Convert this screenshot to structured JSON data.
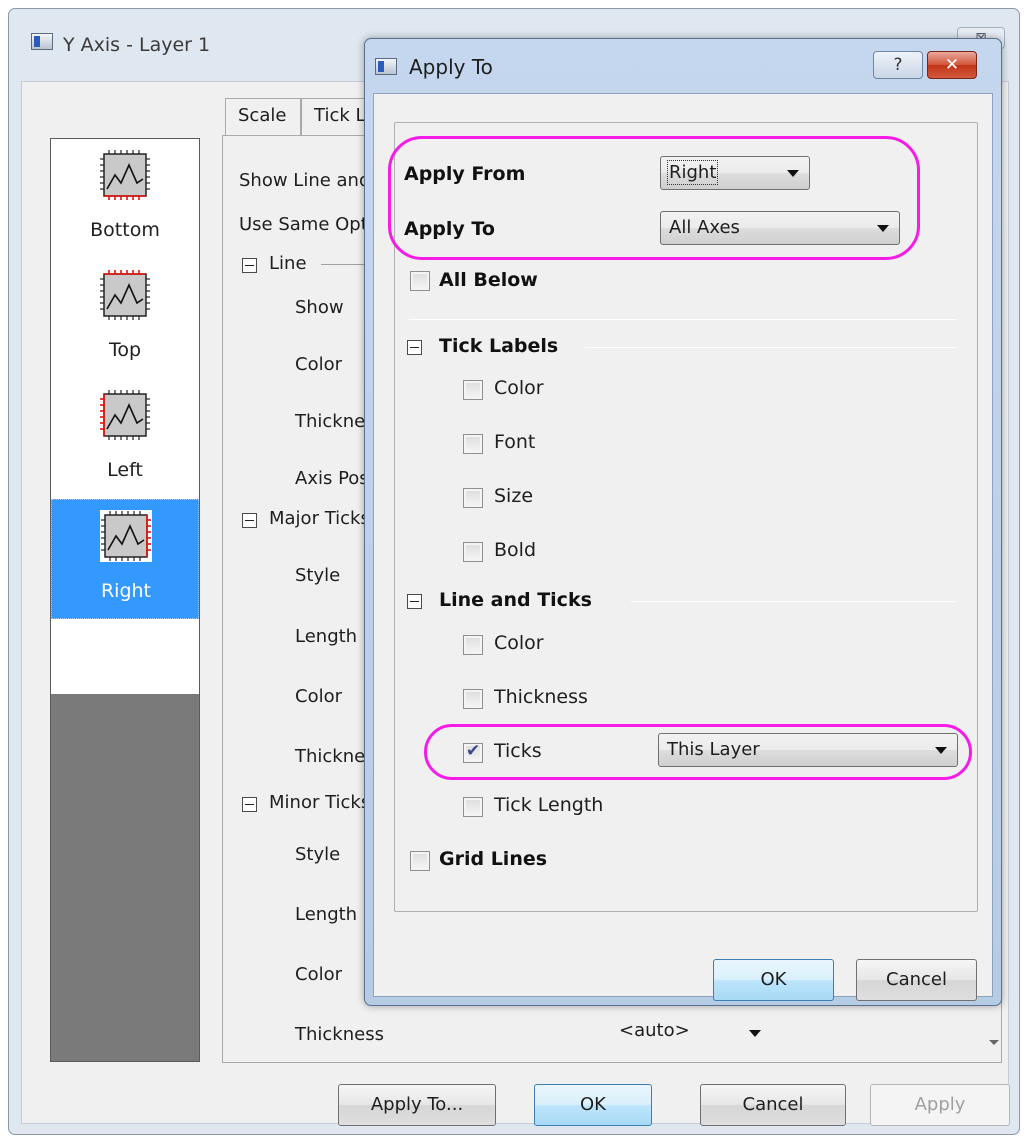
{
  "back_window": {
    "title": "Y Axis - Layer 1",
    "close_glyph": "⊠",
    "axis_list": [
      {
        "label": "Bottom",
        "icon": "axis-bottom-icon",
        "selected": false
      },
      {
        "label": "Top",
        "icon": "axis-top-icon",
        "selected": false
      },
      {
        "label": "Left",
        "icon": "axis-left-icon",
        "selected": false
      },
      {
        "label": "Right",
        "icon": "axis-right-icon",
        "selected": true
      }
    ],
    "tabs": [
      "Scale",
      "Tick La"
    ],
    "rows": {
      "show_line": "Show Line and",
      "use_same": "Use Same Opt",
      "line_group": "Line",
      "show": "Show",
      "color": "Color",
      "thickness_line": "Thicknes",
      "axis_pos": "Axis Pos",
      "major_group": "Major Ticks",
      "major_style": "Style",
      "major_length": "Length",
      "major_color": "Color",
      "major_thickness": "Thicknes",
      "minor_group": "Minor Ticks",
      "minor_style": "Style",
      "minor_length": "Length",
      "minor_color": "Color",
      "minor_thickness": "Thickness"
    },
    "minor_thickness_value": "<auto>",
    "buttons": {
      "apply_to": "Apply To...",
      "ok": "OK",
      "cancel": "Cancel",
      "apply": "Apply"
    }
  },
  "dialog": {
    "title": "Apply To",
    "help_glyph": "?",
    "close_glyph": "✕",
    "apply_from_label": "Apply From",
    "apply_from_value": "Right",
    "apply_to_label": "Apply To",
    "apply_to_value": "All Axes",
    "all_below_label": "All Below",
    "all_below_checked": false,
    "tick_labels_group": "Tick Labels",
    "tick_labels_options": [
      {
        "label": "Color",
        "checked": false
      },
      {
        "label": "Font",
        "checked": false
      },
      {
        "label": "Size",
        "checked": false
      },
      {
        "label": "Bold",
        "checked": false
      }
    ],
    "line_ticks_group": "Line and Ticks",
    "line_color_label": "Color",
    "line_thickness_label": "Thickness",
    "ticks_label": "Ticks",
    "ticks_checked": true,
    "ticks_scope_value": "This Layer",
    "tick_length_label": "Tick Length",
    "grid_lines_label": "Grid Lines",
    "grid_lines_checked": false,
    "ok": "OK",
    "cancel": "Cancel"
  },
  "colors": {
    "highlight": "#f51ce8",
    "selection": "#3399ff",
    "list_bg": "#7a7a7a"
  }
}
